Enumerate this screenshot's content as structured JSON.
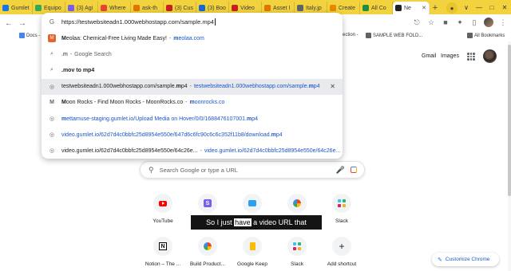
{
  "colors": {
    "tab_strip": "#f2d23d",
    "link_blue": "#1a56c7",
    "caption_bg": "#000000"
  },
  "tabs": [
    {
      "label": "Gumlet",
      "fav_color": "#1a73e8"
    },
    {
      "label": "Equipo",
      "fav_color": "#34a853"
    },
    {
      "label": "(3) Agi",
      "fav_color": "#7b5cf0"
    },
    {
      "label": "Where",
      "fav_color": "#ea4335"
    },
    {
      "label": "ask-th",
      "fav_color": "#e37400"
    },
    {
      "label": "(3) Cus",
      "fav_color": "#c5221f"
    },
    {
      "label": "(3) Boo",
      "fav_color": "#1967d2"
    },
    {
      "label": "Video",
      "fav_color": "#c5221f"
    },
    {
      "label": "Asset I",
      "fav_color": "#e37400"
    },
    {
      "label": "Italy.jp",
      "fav_color": "#5f6368"
    },
    {
      "label": "Create",
      "fav_color": "#ea8600"
    },
    {
      "label": "All Co",
      "fav_color": "#1e8e3e"
    },
    {
      "label": "Ne",
      "fav_color": "#202124",
      "active": true
    }
  ],
  "window_controls": [
    "∨",
    "—",
    "□",
    "✕"
  ],
  "bookmarks": {
    "left_item": "Docs -",
    "middle_item": "ection -",
    "right_item": "SAMPLE WEB FOLD...",
    "all": "All Bookmarks"
  },
  "omnibox": {
    "input_value": "https://testwebsiteadn1.000webhostapp.com/sample.mp4",
    "suggestions": [
      {
        "icon": "meolaa-icon",
        "main_bold": "M",
        "main_rest": "eolaa: Chemical-Free Living Made Easy!",
        "url_bold": "m",
        "url_rest": "eolaa.com"
      },
      {
        "icon": "search-icon",
        "main_bold": "",
        "main_rest": ".m",
        "sub": "Google Search"
      },
      {
        "icon": "search-icon",
        "main_bold": ".mov to mp4",
        "main_rest": ""
      },
      {
        "icon": "globe-icon",
        "main_rest": "testwebsiteadn1.000webhostapp.com/sample.",
        "main_bold": "m",
        "main_tail": "p4",
        "url_rest": "testwebsiteadn1.000webhostapp.com/sample.",
        "url_bold": "m",
        "url_tail": "p4",
        "selected": true,
        "remove": "✕"
      },
      {
        "icon": "moonrocks-icon",
        "main_bold": "M",
        "main_rest": "oon Rocks - Find Moon Rocks - MoonRocks.co",
        "url_bold": "m",
        "url_rest": "oonrocks.co"
      },
      {
        "icon": "globe-icon",
        "link_bold": "m",
        "link_rest": "ettamuse-staging.gumlet.io/Upload Media on Hover/0/0/1688476107001.",
        "link_bold2": "m",
        "link_tail": "p4"
      },
      {
        "icon": "globe-icon",
        "link_rest": "video.gumlet.io/62d7d4c0bbfc25d8954e550e/647d6c6fc90c6c6c352f11b8/download.",
        "link_bold2": "m",
        "link_tail": "p4"
      },
      {
        "icon": "globe-icon",
        "main_rest": "video.gumlet.io/62d7d4c0bbfc25d8954e550e/64c26e...",
        "url_rest": "video.gumlet.io/62d7d4c0bbfc25d8954e550e/64c26e..."
      }
    ]
  },
  "header_links": {
    "gmail": "Gmail",
    "images": "Images"
  },
  "search": {
    "placeholder": "Search Google or type a URL"
  },
  "shortcuts": [
    {
      "label": "YouTube",
      "icon": "youtube-icon"
    },
    {
      "label": "",
      "icon": "s-app-icon"
    },
    {
      "label": "",
      "icon": "message-icon"
    },
    {
      "label": "",
      "icon": "pinwheel-icon"
    },
    {
      "label": "Slack",
      "icon": "slack-icon"
    },
    {
      "label": "Notion – The ...",
      "icon": "notion-icon"
    },
    {
      "label": "Build Product...",
      "icon": "pinwheel-icon"
    },
    {
      "label": "Google Keep",
      "icon": "keep-icon"
    },
    {
      "label": "Slack",
      "icon": "slack-icon"
    },
    {
      "label": "Add shortcut",
      "icon": "plus-icon"
    }
  ],
  "caption": {
    "before": "So I just ",
    "highlight": "have",
    "after": " a video URL that"
  },
  "customize": {
    "label": "Customize Chrome"
  }
}
